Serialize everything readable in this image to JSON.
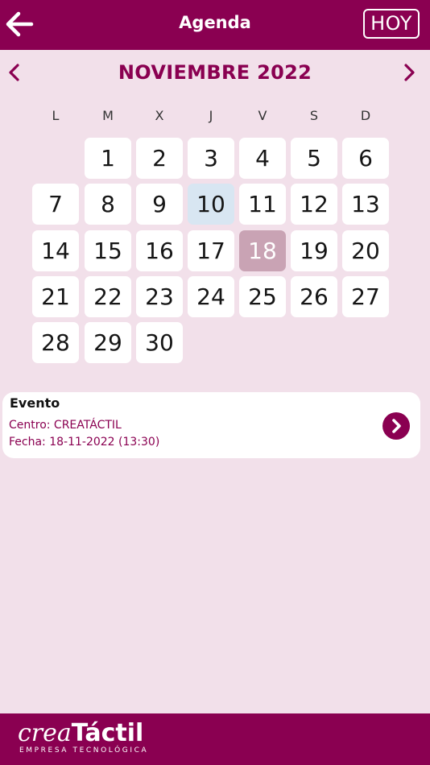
{
  "header": {
    "title": "Agenda",
    "today_button": "HOY",
    "back_icon": "arrow-left-icon",
    "background": "#8a0051"
  },
  "calendar": {
    "month_label": "NOVIEMBRE 2022",
    "prev_icon": "chevron-left-icon",
    "next_icon": "chevron-right-icon",
    "weekdays": [
      "L",
      "M",
      "X",
      "J",
      "V",
      "S",
      "D"
    ],
    "first_weekday_index": 1,
    "days_in_month": 30,
    "today": 10,
    "selected": 18,
    "colors": {
      "accent": "#8a0051",
      "today": "#d8e6f2",
      "selected": "#c9a3b4",
      "background": "#f2e0ea"
    }
  },
  "event": {
    "title": "Evento",
    "centro": "Centro: CREATÁCTIL",
    "fecha": "Fecha: 18-11-2022 (13:30)",
    "arrow_icon": "chevron-right-circle-icon"
  },
  "footer": {
    "logo_crea": "crea",
    "logo_tactil": "Táctil",
    "logo_tagline": "EMPRESA TECNOLÓGICA"
  }
}
